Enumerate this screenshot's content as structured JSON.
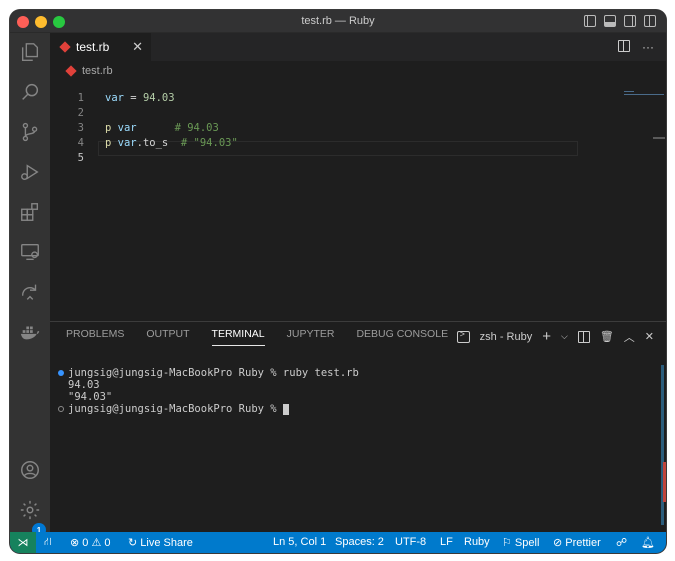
{
  "window": {
    "title": "test.rb — Ruby"
  },
  "tab": {
    "label": "test.rb",
    "close": "✕"
  },
  "breadcrumb": {
    "file": "test.rb"
  },
  "editor": {
    "line_numbers": [
      "1",
      "2",
      "3",
      "4",
      "5"
    ],
    "lines": {
      "l1_var": "var",
      "l1_eq": " = ",
      "l1_num": "94.03",
      "l3_p": "p ",
      "l3_var": "var",
      "l3_sp": "      ",
      "l3_cm": "# 94.03",
      "l4_p": "p ",
      "l4_var": "var",
      "l4_meth": ".to_s  ",
      "l4_cm": "# \"94.03\""
    }
  },
  "panel": {
    "tabs": [
      "PROBLEMS",
      "OUTPUT",
      "TERMINAL",
      "JUPYTER",
      "DEBUG CONSOLE"
    ],
    "active_tab": "TERMINAL",
    "terminal_name": "zsh - Ruby",
    "terminal": {
      "cmd_line": "jungsig@jungsig-MacBookPro Ruby % ruby test.rb",
      "out1": "94.03",
      "out2": "\"94.03\"",
      "prompt": "jungsig@jungsig-MacBookPro Ruby % "
    }
  },
  "activity": {
    "badge": "1"
  },
  "status": {
    "errors": "0",
    "warnings": "0",
    "live_share": "Live Share",
    "position": "Ln 5, Col 1",
    "spaces": "Spaces: 2",
    "encoding": "UTF-8",
    "eol": "LF",
    "language": "Ruby",
    "spell": "Spell",
    "prettier": "Prettier"
  },
  "colors": {
    "accent": "#007acc",
    "remote": "#16825d",
    "badge": "#0078d4"
  }
}
